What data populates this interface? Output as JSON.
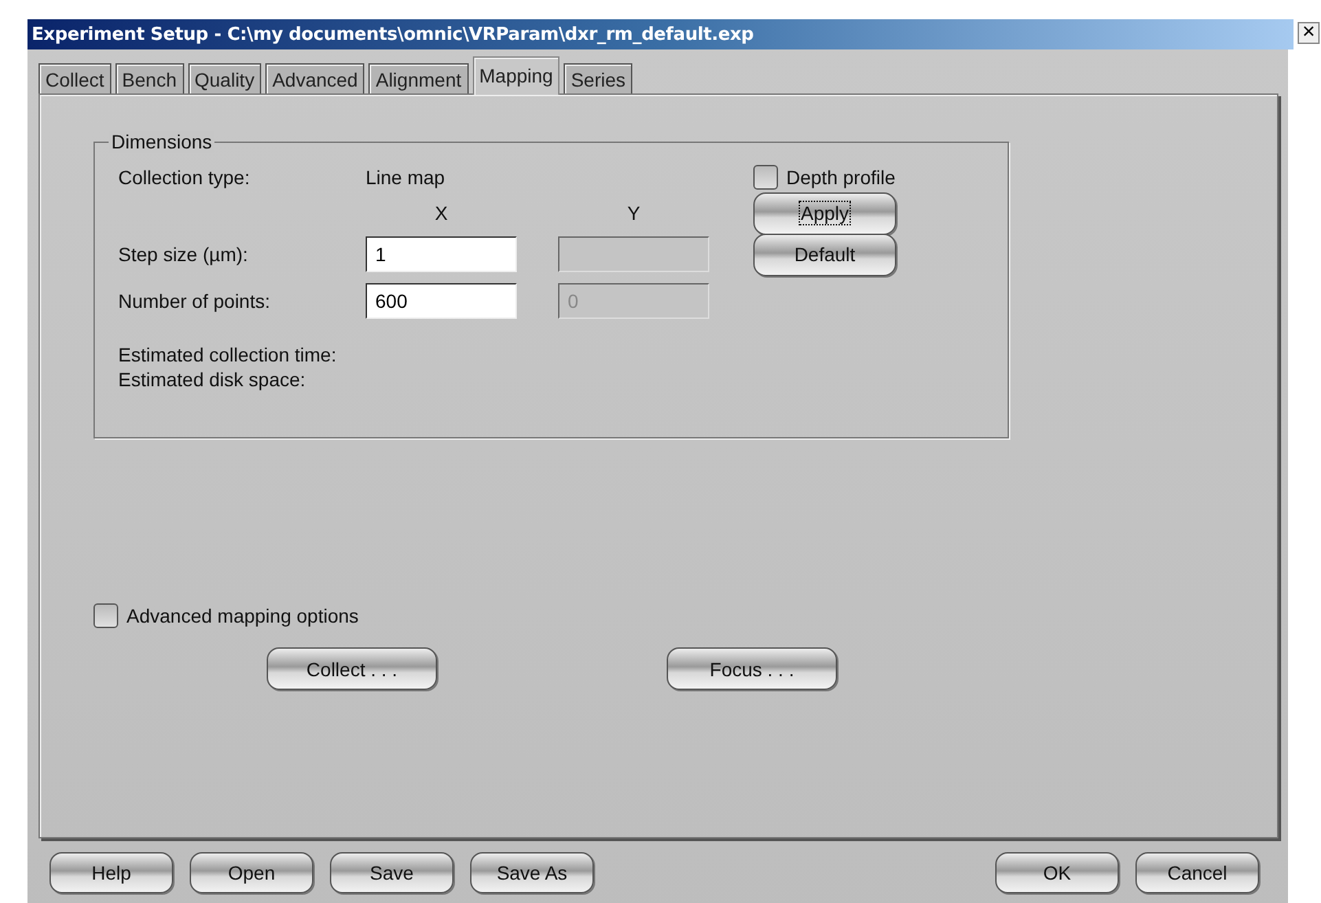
{
  "window": {
    "title": "Experiment Setup - C:\\my documents\\omnic\\VRParam\\dxr_rm_default.exp",
    "close": "×"
  },
  "tabs": [
    {
      "label": "Collect",
      "selected": false
    },
    {
      "label": "Bench",
      "selected": false
    },
    {
      "label": "Quality",
      "selected": false
    },
    {
      "label": "Advanced",
      "selected": false
    },
    {
      "label": "Alignment",
      "selected": false
    },
    {
      "label": "Mapping",
      "selected": true
    },
    {
      "label": "Series",
      "selected": false
    }
  ],
  "dimensions": {
    "title": "Dimensions",
    "collection_type_label": "Collection type:",
    "collection_type_value": "Line map",
    "column_x": "X",
    "column_y": "Y",
    "rows": [
      {
        "label": "Step size  (µm):",
        "x": {
          "value": "1",
          "disabled": false
        },
        "y": {
          "disabled": true
        }
      },
      {
        "label": "Number of points:",
        "x": {
          "value": "600",
          "disabled": false
        },
        "y": {
          "value": "0",
          "disabled": true
        }
      }
    ],
    "estimated_time_label": "Estimated collection time:",
    "estimated_disk_label": "Estimated disk space:",
    "depth_profile": {
      "label": "Depth profile",
      "checked": false
    },
    "buttons": [
      {
        "label": "Apply",
        "focused": true
      },
      {
        "label": "Default",
        "focused": false
      }
    ]
  },
  "advanced_mapping": {
    "label": "Advanced mapping options",
    "checked": false
  },
  "actions": [
    "Collect . . .",
    "Focus . . ."
  ],
  "footer": {
    "left": [
      "Help",
      "Open",
      "Save",
      "Save As"
    ],
    "right": [
      "OK",
      "Cancel"
    ]
  }
}
